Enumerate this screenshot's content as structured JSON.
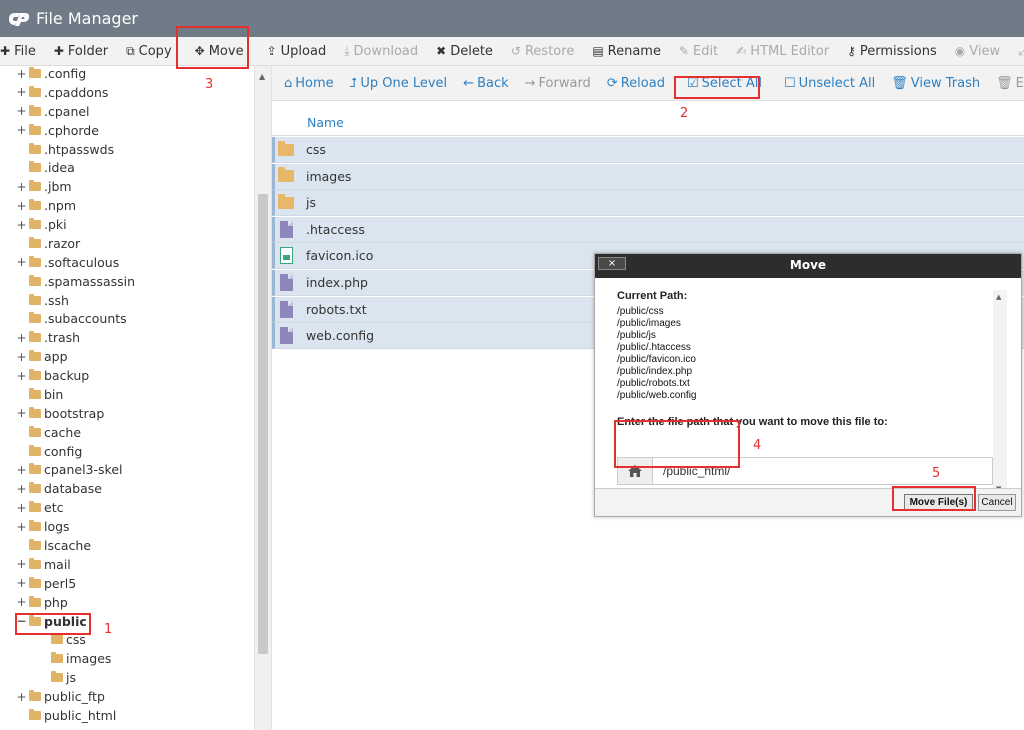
{
  "app": {
    "title": "File Manager"
  },
  "toolbar": {
    "file": "File",
    "folder": "Folder",
    "copy": "Copy",
    "move": "Move",
    "upload": "Upload",
    "download": "Download",
    "delete": "Delete",
    "restore": "Restore",
    "rename": "Rename",
    "edit": "Edit",
    "html_editor": "HTML Editor",
    "permissions": "Permissions",
    "view": "View"
  },
  "nav": {
    "home": "Home",
    "up": "Up One Level",
    "back": "Back",
    "forward": "Forward",
    "reload": "Reload",
    "select_all": "Select All",
    "unselect_all": "Unselect All",
    "view_trash": "View Trash",
    "empty": "Empty"
  },
  "tree": {
    "items": [
      {
        "label": ".config",
        "expand": "+"
      },
      {
        "label": ".cpaddons",
        "expand": "+"
      },
      {
        "label": ".cpanel",
        "expand": "+"
      },
      {
        "label": ".cphorde",
        "expand": "+"
      },
      {
        "label": ".htpasswds",
        "expand": ""
      },
      {
        "label": ".idea",
        "expand": ""
      },
      {
        "label": ".jbm",
        "expand": "+"
      },
      {
        "label": ".npm",
        "expand": "+"
      },
      {
        "label": ".pki",
        "expand": "+"
      },
      {
        "label": ".razor",
        "expand": ""
      },
      {
        "label": ".softaculous",
        "expand": "+"
      },
      {
        "label": ".spamassassin",
        "expand": ""
      },
      {
        "label": ".ssh",
        "expand": ""
      },
      {
        "label": ".subaccounts",
        "expand": ""
      },
      {
        "label": ".trash",
        "expand": "+"
      },
      {
        "label": "app",
        "expand": "+"
      },
      {
        "label": "backup",
        "expand": "+"
      },
      {
        "label": "bin",
        "expand": ""
      },
      {
        "label": "bootstrap",
        "expand": "+"
      },
      {
        "label": "cache",
        "expand": ""
      },
      {
        "label": "config",
        "expand": ""
      },
      {
        "label": "cpanel3-skel",
        "expand": "+"
      },
      {
        "label": "database",
        "expand": "+"
      },
      {
        "label": "etc",
        "expand": "+"
      },
      {
        "label": "logs",
        "expand": "+"
      },
      {
        "label": "lscache",
        "expand": ""
      },
      {
        "label": "mail",
        "expand": "+"
      },
      {
        "label": "perl5",
        "expand": "+"
      },
      {
        "label": "php",
        "expand": "+"
      },
      {
        "label": "public",
        "expand": "−"
      },
      {
        "label": "css",
        "expand": ""
      },
      {
        "label": "images",
        "expand": ""
      },
      {
        "label": "js",
        "expand": ""
      },
      {
        "label": "public_ftp",
        "expand": "+"
      },
      {
        "label": "public_html",
        "expand": ""
      }
    ]
  },
  "file_list": {
    "column_name": "Name",
    "files": [
      {
        "name": "css",
        "icon": "folder-icon"
      },
      {
        "name": "images",
        "icon": "folder-icon"
      },
      {
        "name": "js",
        "icon": "folder-icon"
      },
      {
        "name": ".htaccess",
        "icon": "file-icon"
      },
      {
        "name": "favicon.ico",
        "icon": "image-file-icon"
      },
      {
        "name": "index.php",
        "icon": "file-icon"
      },
      {
        "name": "robots.txt",
        "icon": "file-icon"
      },
      {
        "name": "web.config",
        "icon": "file-icon"
      }
    ]
  },
  "dialog": {
    "title": "Move",
    "close": "×",
    "current_path_label": "Current Path:",
    "paths": [
      "/public/css",
      "/public/images",
      "/public/js",
      "/public/.htaccess",
      "/public/favicon.ico",
      "/public/index.php",
      "/public/robots.txt",
      "/public/web.config"
    ],
    "prompt": "Enter the file path that you want to move this file to:",
    "input_value": "/public_html/",
    "move_button": "Move File(s)",
    "cancel_button": "Cancel"
  },
  "annotations": [
    "1",
    "2",
    "3",
    "4",
    "5"
  ],
  "colors": {
    "header": "#6f7b86",
    "link": "#2f80c1",
    "selected_row": "#dbe5ef",
    "annotation": "#e53030",
    "folder": "#e0b366"
  }
}
